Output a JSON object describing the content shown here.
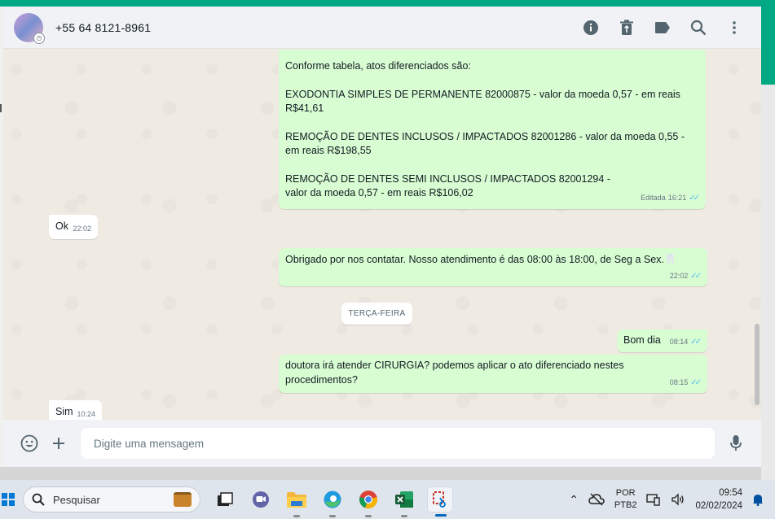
{
  "header": {
    "contact_name": "+55 64 8121-8961",
    "icons": [
      "info-icon",
      "trash-icon",
      "label-icon",
      "search-icon",
      "menu-icon"
    ]
  },
  "messages": [
    {
      "direction": "out",
      "lines": [
        "Conforme tabela, atos diferenciados são:",
        "EXODONTIA SIMPLES DE PERMANENTE 82000875 - valor da moeda 0,57 - em reais R$41,61",
        "REMOÇÃO DE DENTES INCLUSOS / IMPACTADOS 82001286 - valor da moeda 0,55 - em reais R$198,55",
        "REMOÇÃO DE DENTES SEMI INCLUSOS / IMPACTADOS 82001294 - valor da moeda 0,57 - em reais R$106,02"
      ],
      "edited_label": "Editada",
      "time": "16:21"
    },
    {
      "direction": "in",
      "text": "Ok",
      "time": "22:02"
    },
    {
      "direction": "out",
      "text": "Obrigado por nos contatar. Nosso atendimento é das 08:00 às 18:00, de Seg a Sex.",
      "emoji": "🦷",
      "time": "22:02"
    },
    {
      "direction": "out",
      "text": "Bom dia",
      "time": "08:14"
    },
    {
      "direction": "out",
      "text": "doutora irá atender CIRURGIA? podemos aplicar o ato diferenciado nestes procedimentos?",
      "time": "08:15"
    },
    {
      "direction": "in",
      "text": "Sim",
      "time": "10:24"
    }
  ],
  "date_divider": "TERÇA-FEIRA",
  "composer": {
    "placeholder": "Digite uma mensagem"
  },
  "taskbar": {
    "search_label": "Pesquisar",
    "lang_top": "POR",
    "lang_bottom": "PTB2",
    "time": "09:54",
    "date": "02/02/2024"
  },
  "colors": {
    "accent": "#00a884",
    "outgoing": "#d9fdd3",
    "incoming": "#ffffff",
    "ticks": "#53bdeb"
  }
}
